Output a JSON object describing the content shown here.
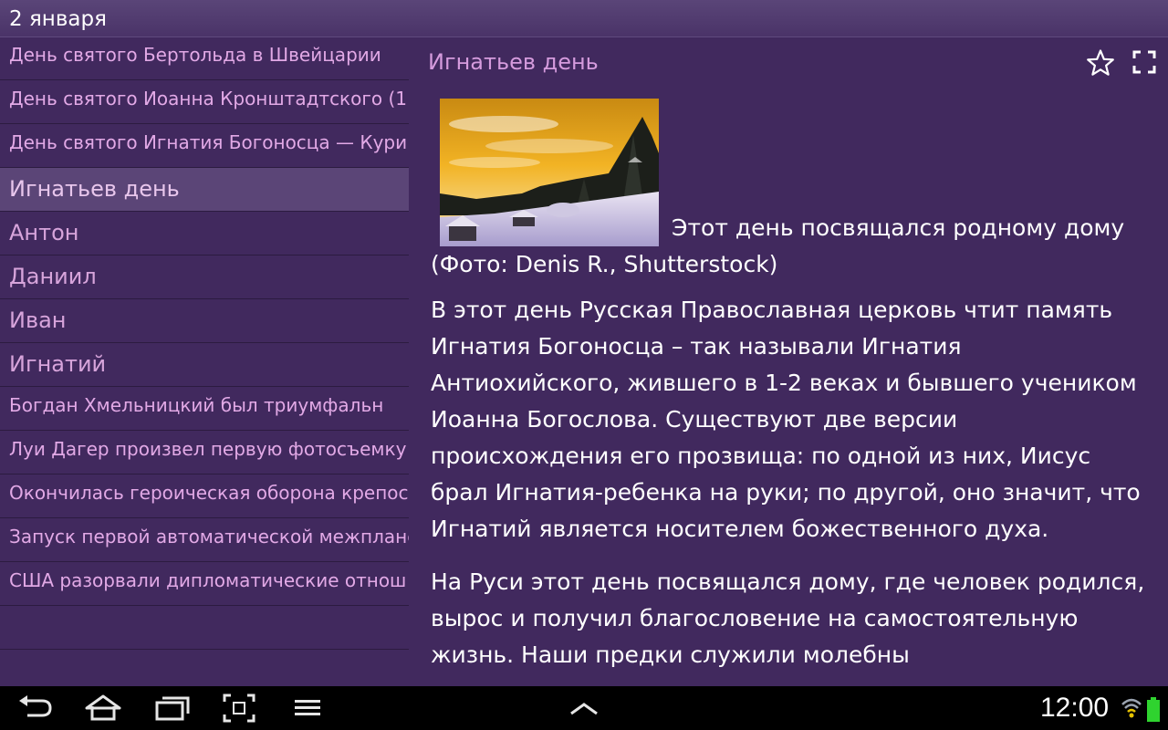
{
  "header": {
    "date": "2 января"
  },
  "sidebar": {
    "items": [
      {
        "label": "День святого Бертольда в Швейцарии",
        "kind": "event"
      },
      {
        "label": "День святого Иоанна Кронштадтского (1",
        "kind": "event"
      },
      {
        "label": "День святого Игнатия Богоносца — Кури",
        "kind": "event"
      },
      {
        "label": "Игнатьев день",
        "kind": "name",
        "selected": true
      },
      {
        "label": "Антон",
        "kind": "name"
      },
      {
        "label": "Даниил",
        "kind": "name"
      },
      {
        "label": "Иван",
        "kind": "name"
      },
      {
        "label": "Игнатий",
        "kind": "name"
      },
      {
        "label": "Богдан Хмельницкий был триумфальн",
        "kind": "event"
      },
      {
        "label": "Луи Дагер произвел первую фотосъемку",
        "kind": "event"
      },
      {
        "label": "Окончилась героическая оборона крепос",
        "kind": "event"
      },
      {
        "label": "Запуск первой автоматической межплане",
        "kind": "event"
      },
      {
        "label": "США разорвали дипломатические отнош",
        "kind": "event"
      }
    ]
  },
  "detail": {
    "title": "Игнатьев день",
    "image_caption_line1": "Этот день посвящался родному дому",
    "image_caption_line2": "(Фото: Denis R., Shutterstock)",
    "paragraph1": "В этот день Русская Православная церковь чтит память Игнатия Богоносца – так называли Игнатия Антиохийского, жившего в 1-2 веках и бывшего учеником Иоанна Богослова. Существуют две версии происхождения его прозвища: по одной из них, Иисус брал Игнатия-ребенка на руки; по другой, оно значит, что Игнатий является носителем божественного духа.",
    "paragraph2": "На Руси этот день посвящался дому, где человек родился, вырос и получил благословение на самостоятельную жизнь. Наши предки служили молебны"
  },
  "status_bar": {
    "time": "12:00"
  },
  "icons": {
    "star": "star-outline-icon",
    "fullscreen": "fullscreen-icon",
    "back": "back-icon",
    "home": "home-icon",
    "recent": "recent-apps-icon",
    "screenshot": "screenshot-icon",
    "menu": "menu-icon",
    "up": "chevron-up-icon",
    "wifi": "wifi-icon",
    "battery": "battery-icon"
  },
  "colors": {
    "background": "#41295e",
    "accent_text": "#d59bdd",
    "selected_item": "#5b4577"
  }
}
